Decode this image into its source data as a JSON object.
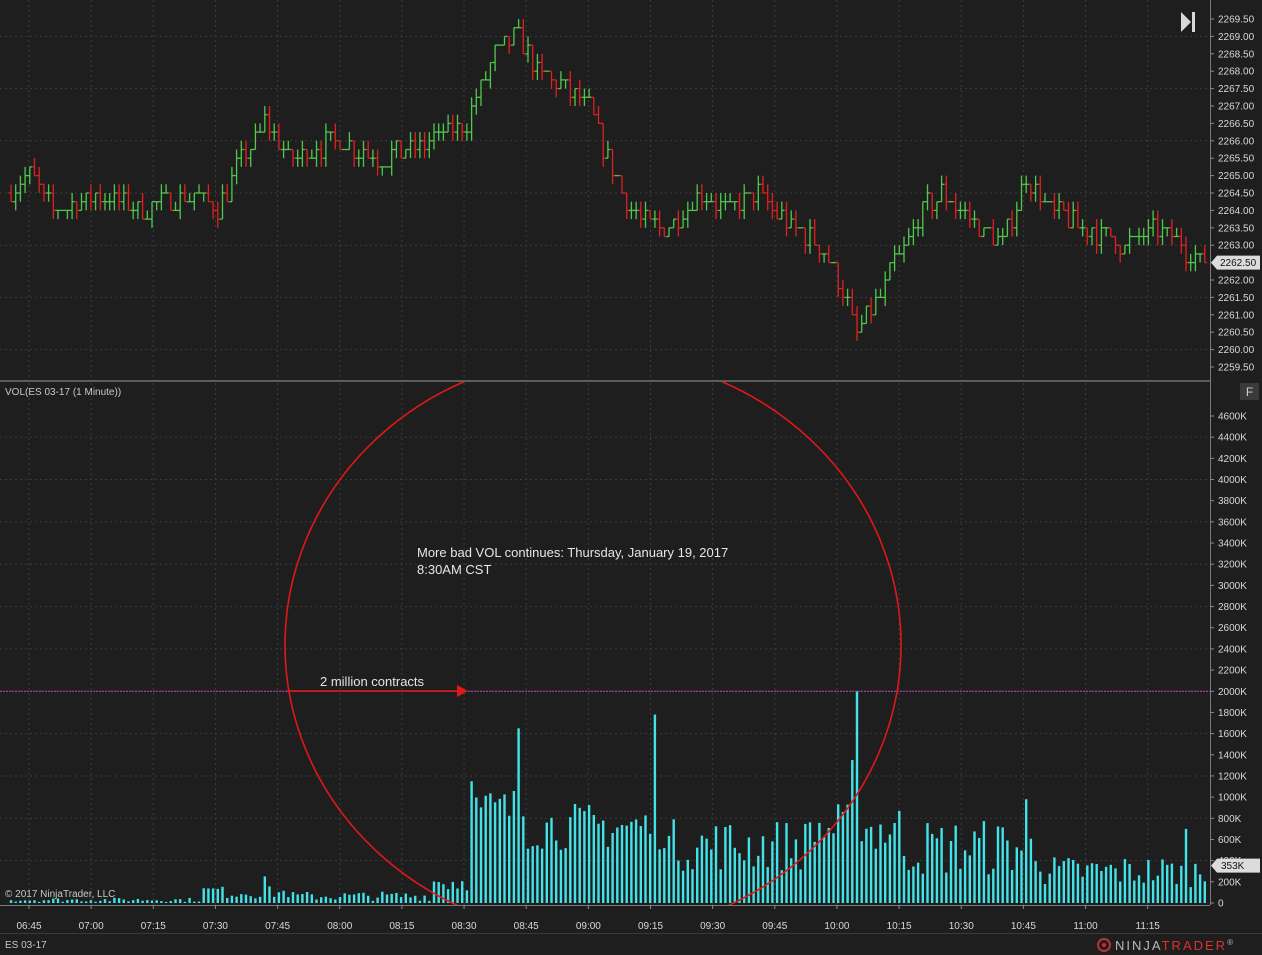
{
  "instrument": "ES 03-17",
  "indicator_label": "VOL(ES 03-17 (1 Minute))",
  "copyright": "© 2017 NinjaTrader, LLC",
  "brand": {
    "part1": "NINJA",
    "part2": "TRADER",
    "mark": "®"
  },
  "panel_button": "F",
  "annotation": {
    "line1": "More bad VOL continues: Thursday, January 19, 2017",
    "line2": "8:30AM CST",
    "arrow_label": "2 million contracts"
  },
  "colors": {
    "background": "#1e1e1e",
    "up_bar": "#4ec94e",
    "down_bar": "#e02020",
    "volume": "#41e3e8",
    "circle": "#e01818",
    "hline": "#c040c0"
  },
  "chart_data": [
    {
      "type": "line",
      "subtype": "ohlc-step",
      "panel": "price",
      "x_labels": [
        "06:45",
        "07:00",
        "07:15",
        "07:30",
        "07:45",
        "08:00",
        "08:15",
        "08:30",
        "08:45",
        "09:00",
        "09:15",
        "09:30",
        "09:45",
        "10:00",
        "10:15",
        "10:30",
        "10:45",
        "11:00",
        "11:15"
      ],
      "y_ticks": [
        "2269.50",
        "2269.00",
        "2268.50",
        "2268.00",
        "2267.50",
        "2267.00",
        "2266.50",
        "2266.00",
        "2265.50",
        "2265.00",
        "2264.50",
        "2264.00",
        "2263.50",
        "2263.00",
        "2262.50",
        "2262.00",
        "2261.50",
        "2261.00",
        "2260.50",
        "2260.00",
        "2259.50"
      ],
      "ylim": [
        2259.5,
        2269.5
      ],
      "last_price": "2262.50",
      "grid": true,
      "keypoints": [
        {
          "x": 0,
          "y": 2264.5
        },
        {
          "x": 5,
          "y": 2265.0
        },
        {
          "x": 10,
          "y": 2264.0
        },
        {
          "x": 20,
          "y": 2264.5
        },
        {
          "x": 30,
          "y": 2264.0
        },
        {
          "x": 40,
          "y": 2264.5
        },
        {
          "x": 45,
          "y": 2264.0
        },
        {
          "x": 50,
          "y": 2265.5
        },
        {
          "x": 55,
          "y": 2266.5
        },
        {
          "x": 60,
          "y": 2265.5
        },
        {
          "x": 70,
          "y": 2266.0
        },
        {
          "x": 80,
          "y": 2265.5
        },
        {
          "x": 90,
          "y": 2266.0
        },
        {
          "x": 98,
          "y": 2266.5
        },
        {
          "x": 104,
          "y": 2268.5
        },
        {
          "x": 109,
          "y": 2269.0
        },
        {
          "x": 113,
          "y": 2268.0
        },
        {
          "x": 119,
          "y": 2267.5
        },
        {
          "x": 124,
          "y": 2267.0
        },
        {
          "x": 128,
          "y": 2265.5
        },
        {
          "x": 133,
          "y": 2264.0
        },
        {
          "x": 137,
          "y": 2263.5
        },
        {
          "x": 141,
          "y": 2263.5
        },
        {
          "x": 148,
          "y": 2264.5
        },
        {
          "x": 154,
          "y": 2264.0
        },
        {
          "x": 160,
          "y": 2264.5
        },
        {
          "x": 167,
          "y": 2263.5
        },
        {
          "x": 173,
          "y": 2263.0
        },
        {
          "x": 177,
          "y": 2262.0
        },
        {
          "x": 181,
          "y": 2260.5
        },
        {
          "x": 184,
          "y": 2261.0
        },
        {
          "x": 189,
          "y": 2262.5
        },
        {
          "x": 195,
          "y": 2264.0
        },
        {
          "x": 199,
          "y": 2264.5
        },
        {
          "x": 207,
          "y": 2263.5
        },
        {
          "x": 212,
          "y": 2263.0
        },
        {
          "x": 217,
          "y": 2265.0
        },
        {
          "x": 222,
          "y": 2264.0
        },
        {
          "x": 230,
          "y": 2263.5
        },
        {
          "x": 238,
          "y": 2263.0
        },
        {
          "x": 245,
          "y": 2263.5
        },
        {
          "x": 250,
          "y": 2263.0
        },
        {
          "x": 254,
          "y": 2262.5
        }
      ]
    },
    {
      "type": "bar",
      "panel": "volume",
      "series_label": "VOL",
      "y_ticks": [
        "4600K",
        "4400K",
        "4200K",
        "4000K",
        "3800K",
        "3600K",
        "3400K",
        "3200K",
        "3000K",
        "2800K",
        "2600K",
        "2400K",
        "2200K",
        "2000K",
        "1800K",
        "1600K",
        "1400K",
        "1200K",
        "1000K",
        "800K",
        "600K",
        "400K",
        "200K",
        "0"
      ],
      "ylim": [
        0,
        4700000
      ],
      "last_value": "353K",
      "reference_line": 2000000,
      "spikes": [
        {
          "x": 98,
          "value": 1150000
        },
        {
          "x": 108,
          "value": 1650000
        },
        {
          "x": 137,
          "value": 1780000
        },
        {
          "x": 179,
          "value": 1350000
        },
        {
          "x": 180,
          "value": 2000000
        },
        {
          "x": 216,
          "value": 980000
        },
        {
          "x": 250,
          "value": 700000
        }
      ]
    }
  ]
}
